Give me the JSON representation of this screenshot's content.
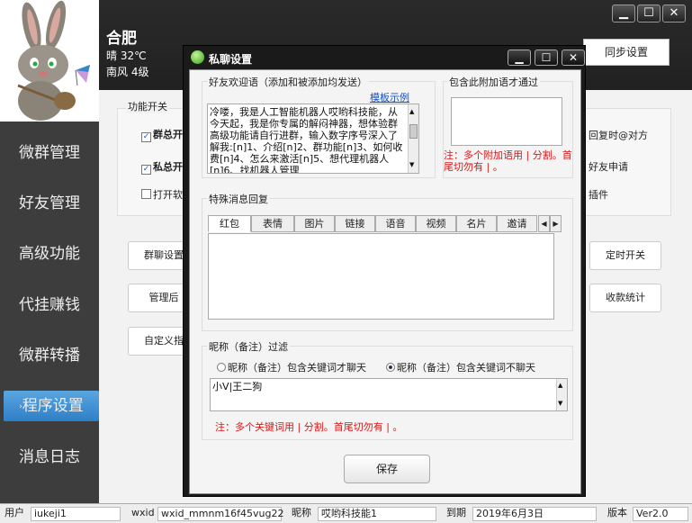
{
  "header": {
    "city": "合肥",
    "weather_line1": "晴  32℃",
    "weather_line2": "南风  4级",
    "sync_button": "同步设置"
  },
  "sidebar": {
    "items": [
      {
        "label": "微群管理"
      },
      {
        "label": "好友管理"
      },
      {
        "label": "高级功能"
      },
      {
        "label": "代挂赚钱"
      },
      {
        "label": "微群转播"
      },
      {
        "label": "程序设置"
      },
      {
        "label": "消息日志"
      }
    ]
  },
  "background": {
    "feature_group_title": "功能开关",
    "cb1_label": "群总开",
    "cb2_label": "私总开",
    "cb3_label": "打开软",
    "right_text1": "回复时@对方",
    "right_text2": "好友申请",
    "right_text3": "插件",
    "btn_group_settings": "群聊设置",
    "btn_manage": "管理后",
    "btn_custom": "自定义指",
    "btn_timer": "定时开关",
    "btn_stats": "收款统计"
  },
  "dialog": {
    "title": "私聊设置",
    "welcome_title": "好友欢迎语（添加和被添加均发送）",
    "template_link": "模板示例",
    "welcome_text": "冷喽，我是人工智能机器人哎哟科技能，从今天起，我是你专属的解闷神器，想体验群高级功能请自行进群，输入数字序号深入了解我:[n]1、介绍[n]2、群功能[n]3、如何收费[n]4、怎么来激活[n]5、想代理机器人[n]6、找机器人管理",
    "addon_title": "包含此附加语才通过",
    "addon_text": "",
    "addon_note": "注：多个附加语用 | 分割。首尾切勿有 | 。",
    "special_title": "特殊消息回复",
    "tabs": [
      "红包",
      "表情",
      "图片",
      "链接",
      "语音",
      "视频",
      "名片",
      "邀请"
    ],
    "tab_text": "",
    "nickname_title": "昵称（备注）过滤",
    "radio1": "昵称（备注）包含关键词才聊天",
    "radio2": "昵称（备注）包含关键词不聊天",
    "nickname_text": "小V|王二狗",
    "nickname_note": "注：多个关键词用 | 分割。首尾切勿有 | 。",
    "save_button": "保存"
  },
  "status": {
    "user_label": "用户",
    "user_value": "iukeji1",
    "wxid_label": "wxid",
    "wxid_value": "wxid_mmnm16f45vug22",
    "nick_label": "昵称",
    "nick_value": "哎哟科技能1",
    "expire_label": "到期",
    "expire_value": "2019年6月3日",
    "version_label": "版本",
    "version_value": "Ver2.0"
  },
  "colors": {
    "accent": "#2f7fc7",
    "warn": "#d81818"
  }
}
